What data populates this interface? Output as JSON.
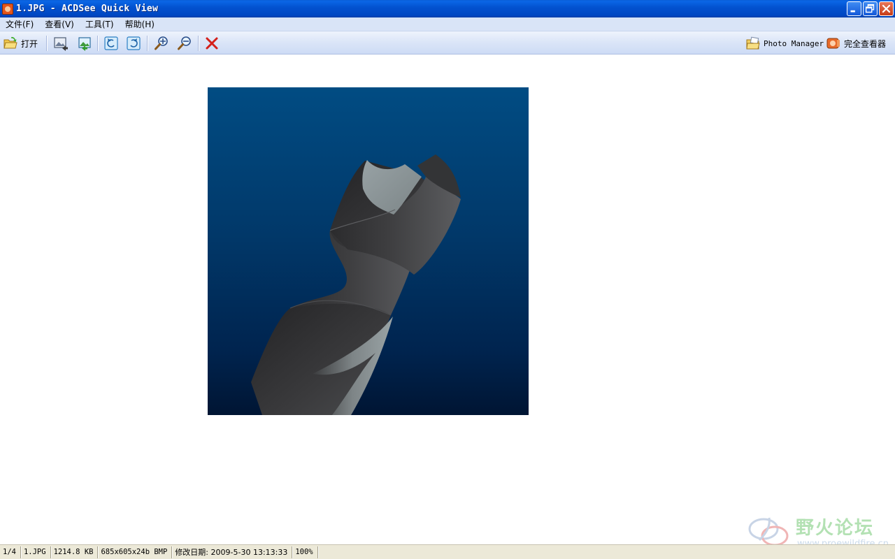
{
  "window": {
    "title": "1.JPG - ACDSee Quick View",
    "app_icon": "acdsee-icon",
    "controls": [
      "minimize-icon",
      "restore-icon",
      "close-icon"
    ]
  },
  "menu": {
    "items": [
      {
        "label": "文件(F)"
      },
      {
        "label": "查看(V)"
      },
      {
        "label": "工具(T)"
      },
      {
        "label": "帮助(H)"
      }
    ]
  },
  "toolbar": {
    "open_label": "打开",
    "buttons": [
      "open-folder-icon",
      "previous-image-icon",
      "next-image-icon",
      "rotate-left-icon",
      "rotate-right-icon",
      "zoom-in-icon",
      "zoom-out-icon",
      "delete-icon"
    ],
    "photo_manager_label": "Photo Manager",
    "full_viewer_label": "完全查看器"
  },
  "image": {
    "description_icon": "drill-bit-render",
    "background_top": "#014c83",
    "background_bottom": "#001533"
  },
  "watermark": {
    "text": "野火论坛",
    "url": "www.proewildfire.cn"
  },
  "status": {
    "index": "1/4",
    "filename": "1.JPG",
    "filesize": "1214.8 KB",
    "dimensions": "685x605x24b BMP",
    "modified": "修改日期: 2009-5-30 13:13:33",
    "zoom": "100%"
  },
  "colors": {
    "titlebar": "#0353d0",
    "menubar": "#d9e4f7",
    "statusbar": "#ece9d8",
    "delete_red": "#d4201a"
  }
}
